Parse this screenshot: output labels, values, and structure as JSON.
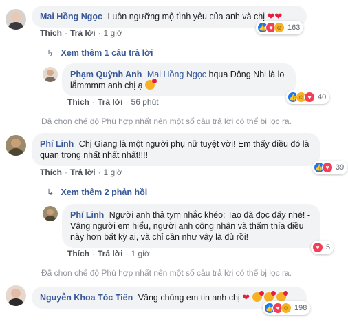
{
  "comments": [
    {
      "author": "Mai Hồng Ngọc",
      "text": "Luôn ngưỡng mộ tình yêu của anh và chị",
      "like_label": "Thích",
      "reply_label": "Trả lời",
      "time": "1 giờ",
      "reaction_count": "163"
    },
    {
      "author": "Phạm Quỳnh Anh",
      "mention": "Mai Hồng Ngọc",
      "text": "hqua Đông Nhi là lo lắmmmm anh chị ạ",
      "like_label": "Thích",
      "reply_label": "Trả lời",
      "time": "56 phút",
      "reaction_count": "40"
    },
    {
      "author": "Phí Linh",
      "text": "Chị Giang là một người phụ nữ tuyệt vời! Em thấy điều đó là quan trọng nhất nhất nhất!!!!",
      "like_label": "Thích",
      "reply_label": "Trả lời",
      "time": "1 giờ",
      "reaction_count": "39"
    },
    {
      "author": "Phí Linh",
      "text": "Người anh thả tym nhắc khéo: Tao đã đọc đấy nhé! - Vâng người em hiểu, người anh công nhận và thấm thía điều này hơn bất kỳ ai, và chỉ cần như vậy là đủ rồi!",
      "like_label": "Thích",
      "reply_label": "Trả lời",
      "time": "1 giờ",
      "reaction_count": "5"
    },
    {
      "author": "Nguyễn Khoa Tóc Tiên",
      "text": "Vâng chúng em tin anh chị",
      "reaction_count": "198"
    }
  ],
  "view_more_1": "Xem thêm 1 câu trả lời",
  "view_more_2": "Xem thêm 2 phản hồi",
  "filter_notice": "Đã chọn chế độ Phù hợp nhất nên một số câu trả lời có thể bị lọc ra.",
  "colors": {
    "link": "#385898",
    "bubble": "#f2f3f5",
    "like": "#1877f2",
    "love": "#f33e58",
    "haha": "#f7b125"
  }
}
